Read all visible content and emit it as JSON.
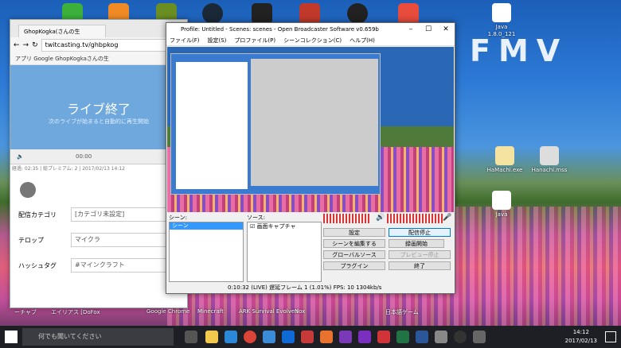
{
  "desktop": {
    "brand": "FMV",
    "icons": [
      {
        "label": "Java",
        "sub": "1.8.0_121"
      },
      {
        "label": "HaMachi.exe"
      },
      {
        "label": "Hanachi.mss"
      },
      {
        "label": "Java"
      }
    ],
    "bottom_labels": [
      "ーチャブ",
      "エイリアス [DoFox",
      "Google Chrome",
      "Minecraft",
      "ARK Survival Evolved",
      "Nox",
      "日本語ゲーム"
    ]
  },
  "browser": {
    "tab_title": "GhopKogka(さんの生",
    "url": "twitcasting.tv/ghbpkog",
    "bookmarks": "アプリ  Google  GhopKogkaさんの生",
    "video_title": "ライブ終了",
    "video_sub": "次のライブが始まると自動的に再生開始",
    "time": "00:00",
    "info": "経過: 02:35 | 総プレミアム: 2 | 2017/02/13 14:12",
    "form": [
      {
        "label": "配信カテゴリ",
        "value": "[カテゴリ未設定]"
      },
      {
        "label": "テロップ",
        "value": "マイクラ"
      },
      {
        "label": "ハッシュタグ",
        "value": "#マインクラフト"
      }
    ]
  },
  "obs": {
    "title": "Profile: Untitled - Scenes: scenes - Open Broadcaster Software v0.659b",
    "menu": [
      "ファイル(F)",
      "設定(S)",
      "プロファイル(P)",
      "シーンコレクション(C)",
      "ヘルプ(H)"
    ],
    "scenes_label": "シーン:",
    "sources_label": "ソース:",
    "scene_item": "シーン",
    "source_item": "画面キャプチャ",
    "buttons": {
      "settings": "設定",
      "stop_stream": "配信停止",
      "edit_scene": "シーンを編集する",
      "global_sources": "グローバルソース",
      "plugins": "プラグイン",
      "record": "録画開始",
      "preview": "プレビュー停止",
      "exit": "終了"
    },
    "status": "0:10:32 (LIVE)  遅延フレーム  1 (1.01%)  FPS: 10  1304kb/s"
  },
  "taskbar": {
    "search_placeholder": "何でも聞いてください",
    "time": "14:12",
    "date": "2017/02/13"
  },
  "colors": {
    "accent": "#0078d7",
    "taskbar": "#1d1f25",
    "video": "#6fa8dc"
  }
}
